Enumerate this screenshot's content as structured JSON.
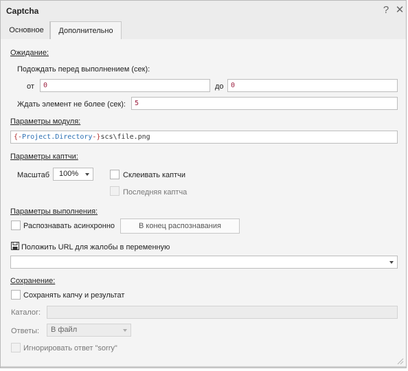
{
  "window": {
    "title": "Captcha"
  },
  "titlebar": {
    "help_icon": "question-icon",
    "close_icon": "close-icon",
    "help_glyph": "?",
    "close_glyph": "✕"
  },
  "tabs": [
    {
      "label": "Основное",
      "active": false
    },
    {
      "label": "Дополнительно",
      "active": true
    }
  ],
  "wait": {
    "heading": "Ожидание:",
    "before_label": "Подождать перед выполнением (сек):",
    "from_label": "от",
    "from_value": "0",
    "to_label": "до",
    "to_value": "0",
    "element_label": "Ждать элемент не более (сек):",
    "element_value": "5"
  },
  "module": {
    "heading": "Параметры модуля:",
    "path_prefix_brace_open": "{-",
    "path_var": "Project.Directory",
    "path_prefix_brace_close": "-}",
    "path_rest": "scs\\file.png"
  },
  "captcha": {
    "heading": "Параметры каптчи:",
    "scale_label": "Масштаб",
    "scale_value": "100%",
    "glue_label": "Склеивать каптчи",
    "last_label": "Последняя каптча"
  },
  "execution": {
    "heading": "Параметры выполнения:",
    "async_label": "Распознавать асинхронно",
    "end_button": "В конец распознавания",
    "complaint_label": "Положить URL для жалобы в переменную",
    "complaint_icon": "save-icon",
    "complaint_value": ""
  },
  "saving": {
    "heading": "Сохранение:",
    "save_label": "Сохранять капчу и результат",
    "catalog_label": "Каталог:",
    "catalog_value": "",
    "answers_label": "Ответы:",
    "answers_value": "В файл",
    "ignore_label": "Игнорировать ответ \"sorry\""
  },
  "colors": {
    "accent_text": "#9b1f3f",
    "var_color": "#2b6fb3",
    "brace_color": "#b02a2a"
  }
}
